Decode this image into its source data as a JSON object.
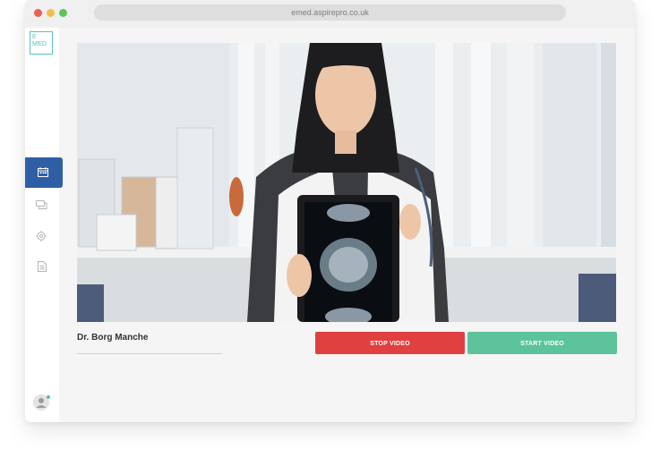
{
  "browser": {
    "url": "emed.aspirepro.co.uk"
  },
  "app": {
    "logo_line1": "E",
    "logo_line2": "MED"
  },
  "sidebar": {
    "items": [
      {
        "icon": "calendar-icon",
        "active": true
      },
      {
        "icon": "chat-icon",
        "active": false
      },
      {
        "icon": "gear-icon",
        "active": false
      },
      {
        "icon": "document-icon",
        "active": false
      }
    ],
    "avatar_icon": "user-icon",
    "accent_color": "#2e5fa5"
  },
  "call": {
    "doctor_name": "Dr. Borg Manche",
    "stop_label": "STOP VIDEO",
    "start_label": "START VIDEO",
    "stop_color": "#e04040",
    "start_color": "#5cc39a"
  }
}
